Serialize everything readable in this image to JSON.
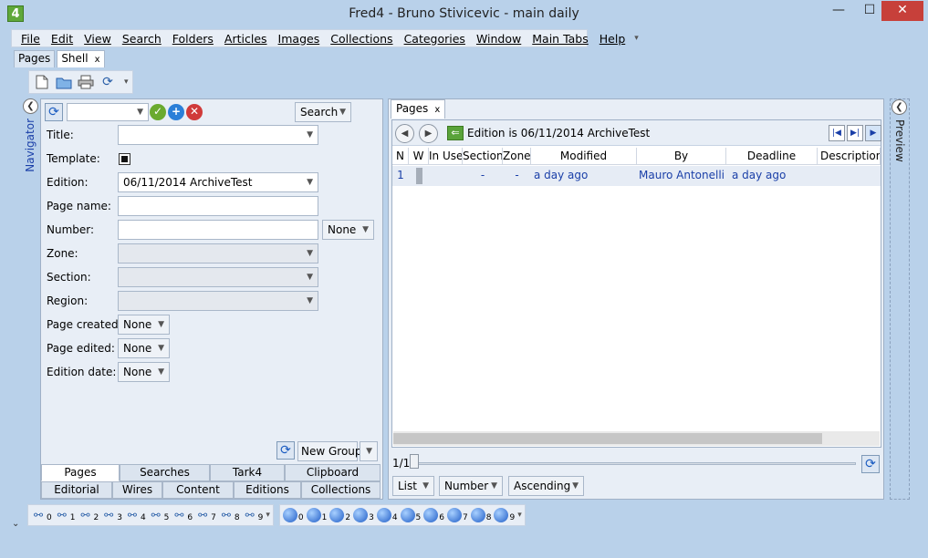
{
  "window": {
    "title": "Fred4 - Bruno Stivicevic - main daily",
    "app_icon_label": "4",
    "minimize": "—",
    "maximize": "☐",
    "close": "✕"
  },
  "menu": [
    "File",
    "Edit",
    "View",
    "Search",
    "Folders",
    "Articles",
    "Images",
    "Collections",
    "Categories",
    "Window",
    "Main Tabs",
    "Help"
  ],
  "doc_tabs": [
    {
      "label": "Pages",
      "closable": false
    },
    {
      "label": "Shell",
      "closable": true
    }
  ],
  "tab_close": "x",
  "navigator": {
    "label": "Navigator",
    "search_button": "Search",
    "fields": {
      "title_label": "Title:",
      "template_label": "Template:",
      "edition_label": "Edition:",
      "edition_value": "06/11/2014 ArchiveTest",
      "page_name_label": "Page name:",
      "number_label": "Number:",
      "number_mode": "None",
      "zone_label": "Zone:",
      "section_label": "Section:",
      "region_label": "Region:",
      "page_created_label": "Page created:",
      "page_created_value": "None",
      "page_edited_label": "Page edited:",
      "page_edited_value": "None",
      "edition_date_label": "Edition date:",
      "edition_date_value": "None"
    },
    "new_group_button": "New Group",
    "tabs_row1": [
      "Pages",
      "Searches",
      "Tark4",
      "Clipboard"
    ],
    "tabs_row2": [
      "Editorial",
      "Wires",
      "Content",
      "Editions",
      "Collections"
    ]
  },
  "pages_panel": {
    "tab_label": "Pages",
    "filter_text": "Edition is 06/11/2014 ArchiveTest",
    "columns": [
      "N",
      "W",
      "In Use",
      "Section",
      "Zone",
      "Modified",
      "By",
      "Deadline",
      "Description"
    ],
    "rows": [
      {
        "n": "1",
        "w": "",
        "in_use": "",
        "section": "-",
        "zone": "-",
        "modified": "a day ago",
        "by": "Mauro Antonelli",
        "deadline": "a day ago",
        "description": ""
      }
    ],
    "pager": "1/1",
    "list_mode": "List",
    "sort_field": "Number",
    "sort_order": "Ascending"
  },
  "preview": {
    "label": "Preview"
  },
  "statusbar": {
    "binocular_slots": [
      "0",
      "1",
      "2",
      "3",
      "4",
      "5",
      "6",
      "7",
      "8",
      "9"
    ],
    "globe_slots": [
      "0",
      "1",
      "2",
      "3",
      "4",
      "5",
      "6",
      "7",
      "8",
      "9"
    ]
  }
}
